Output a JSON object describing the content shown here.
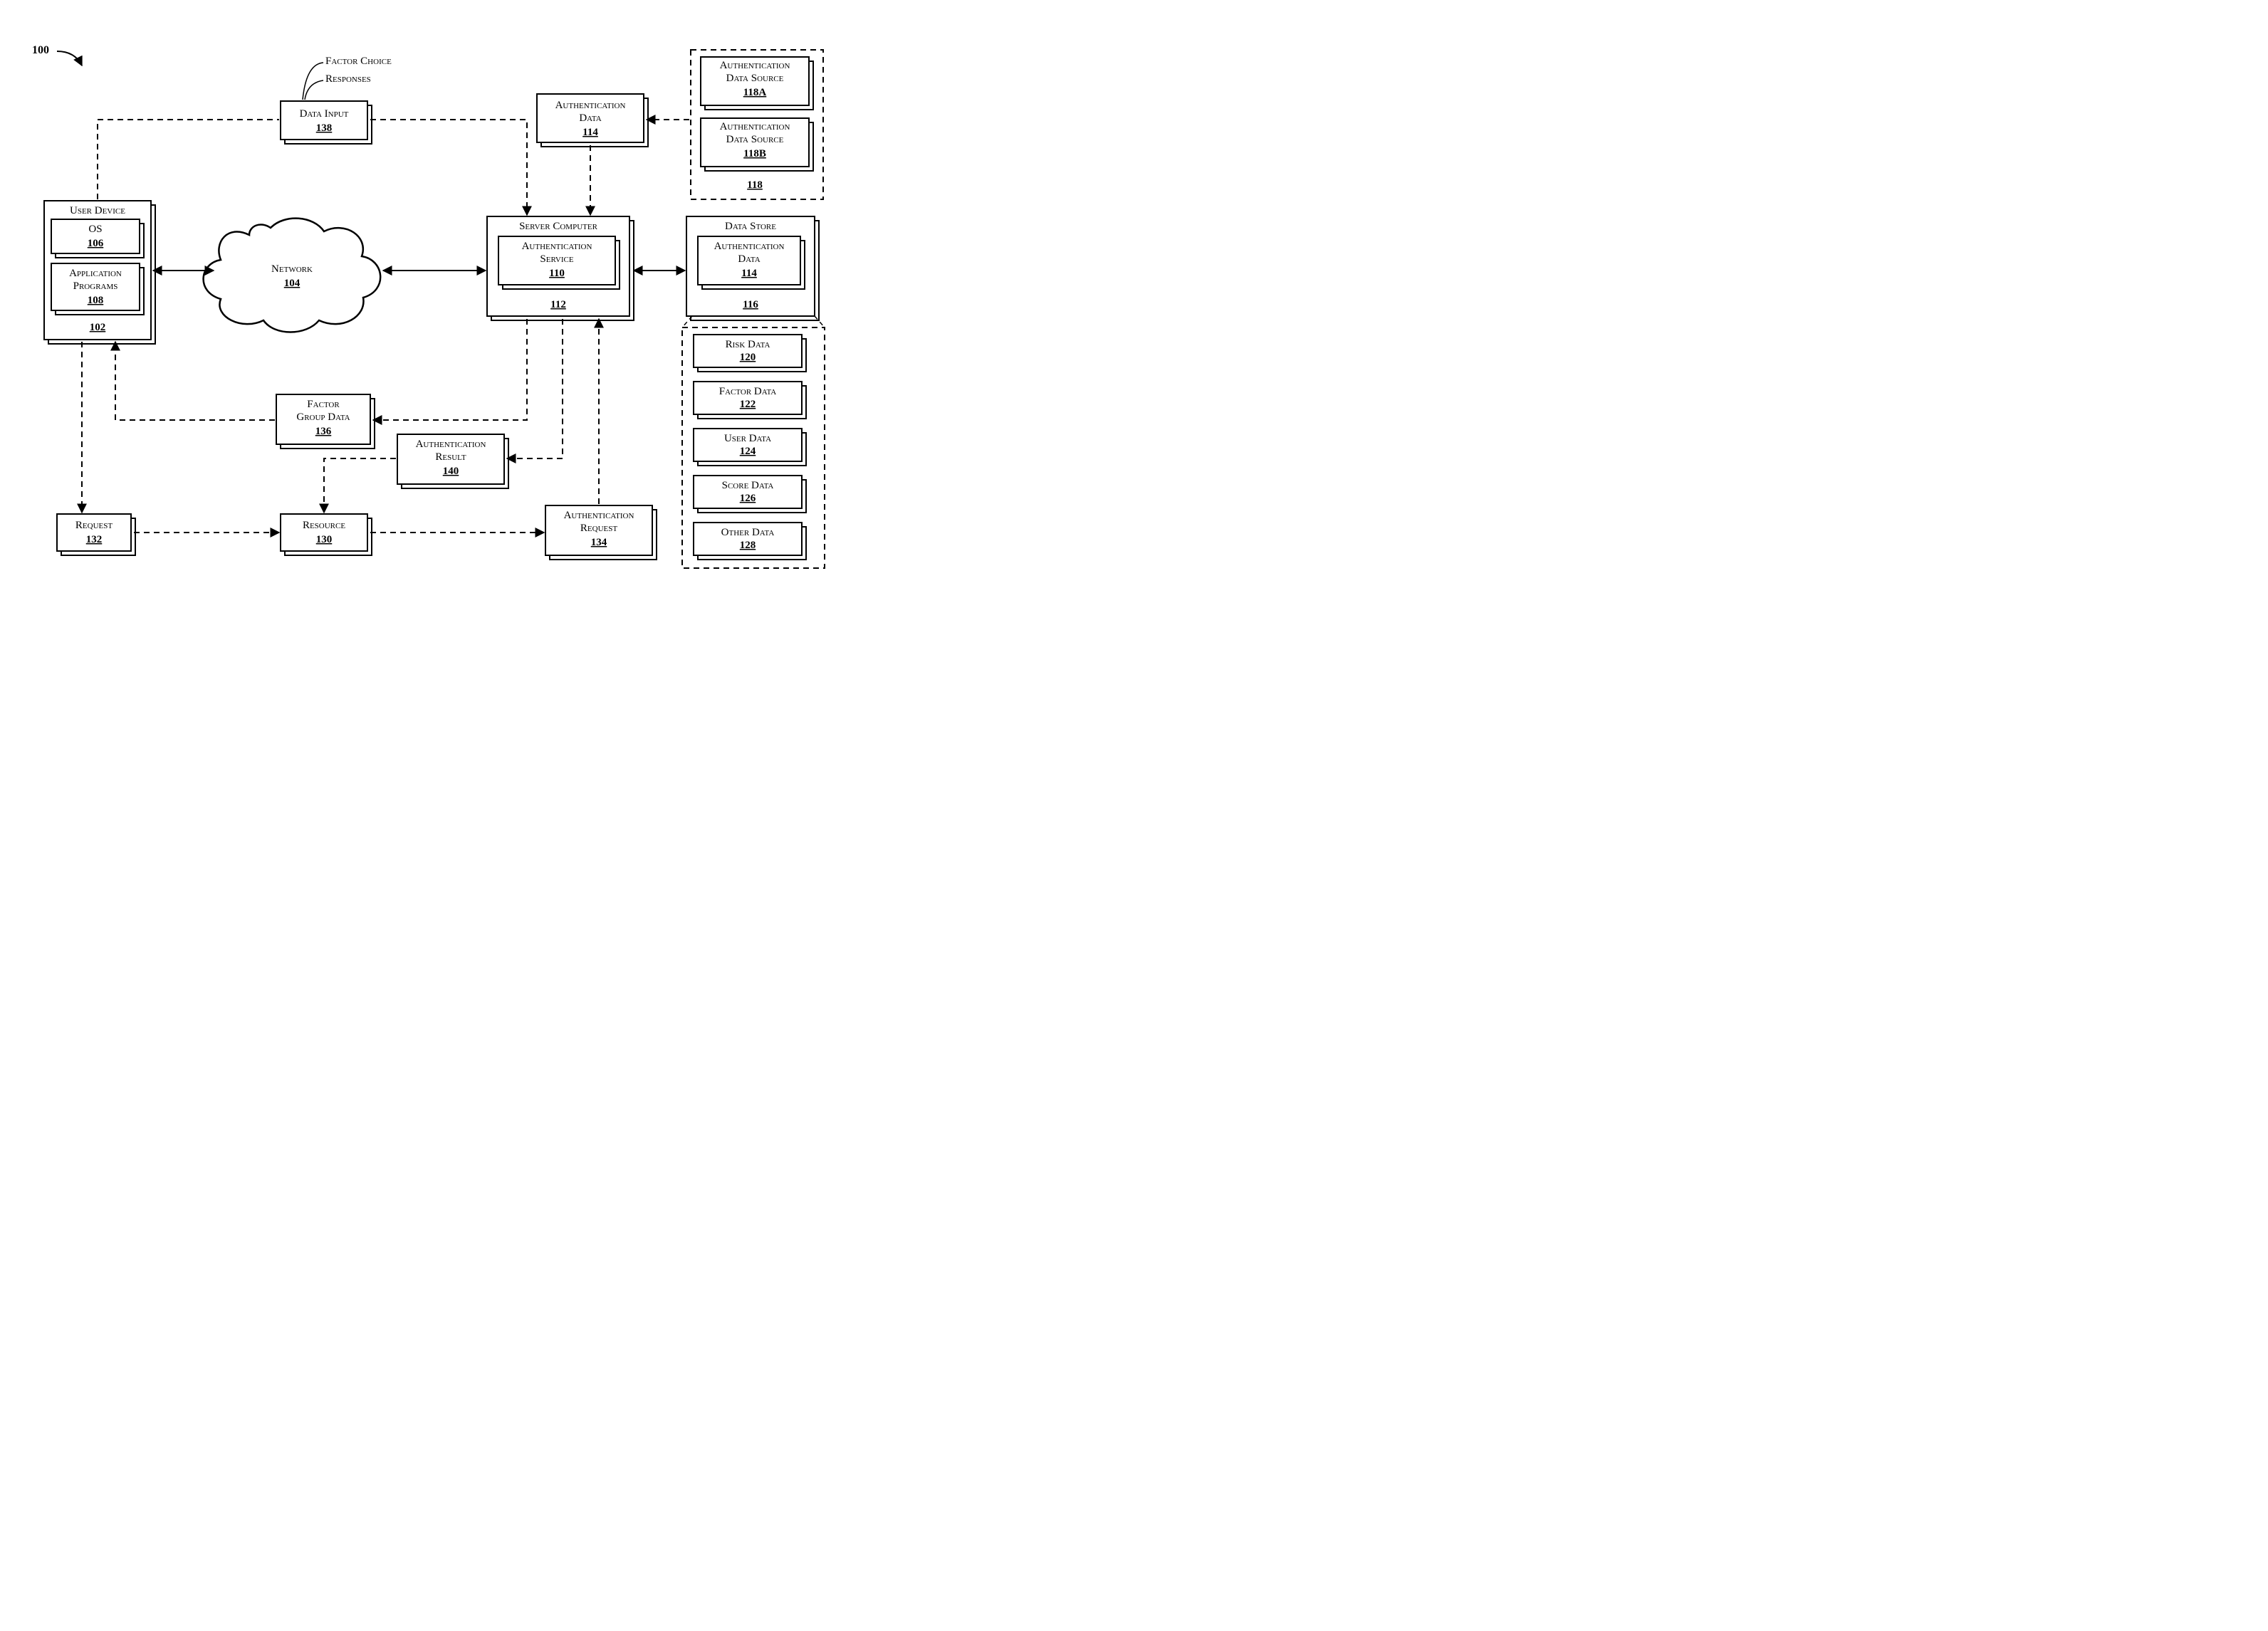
{
  "figure_label": "100",
  "annotations": {
    "factor_choice": "Factor Choice",
    "responses": "Responses"
  },
  "blocks": {
    "user_device": {
      "title": "User Device",
      "ref": "102"
    },
    "os": {
      "title": "OS",
      "ref": "106"
    },
    "app_programs": {
      "title": "Application Programs",
      "ref": "108"
    },
    "network": {
      "title": "Network",
      "ref": "104"
    },
    "data_input": {
      "title": "Data Input",
      "ref": "138"
    },
    "auth_data_top": {
      "title": "Authentication Data",
      "ref": "114"
    },
    "server_computer": {
      "title": "Server Computer",
      "ref": "112"
    },
    "auth_service": {
      "title": "Authentication Service",
      "ref": "110"
    },
    "data_store": {
      "title": "Data Store",
      "ref": "116"
    },
    "auth_data_ds": {
      "title": "Authentication Data",
      "ref": "114"
    },
    "auth_src_a": {
      "title": "Authentication Data Source",
      "ref": "118A"
    },
    "auth_src_b": {
      "title": "Authentication Data Source",
      "ref": "118B"
    },
    "auth_src_group": {
      "ref": "118"
    },
    "factor_group_data": {
      "title": "Factor Group Data",
      "ref": "136"
    },
    "auth_result": {
      "title": "Authentication Result",
      "ref": "140"
    },
    "request": {
      "title": "Request",
      "ref": "132"
    },
    "resource": {
      "title": "Resource",
      "ref": "130"
    },
    "auth_request": {
      "title": "Authentication Request",
      "ref": "134"
    },
    "risk_data": {
      "title": "Risk Data",
      "ref": "120"
    },
    "factor_data": {
      "title": "Factor Data",
      "ref": "122"
    },
    "user_data": {
      "title": "User Data",
      "ref": "124"
    },
    "score_data": {
      "title": "Score Data",
      "ref": "126"
    },
    "other_data": {
      "title": "Other Data",
      "ref": "128"
    }
  }
}
